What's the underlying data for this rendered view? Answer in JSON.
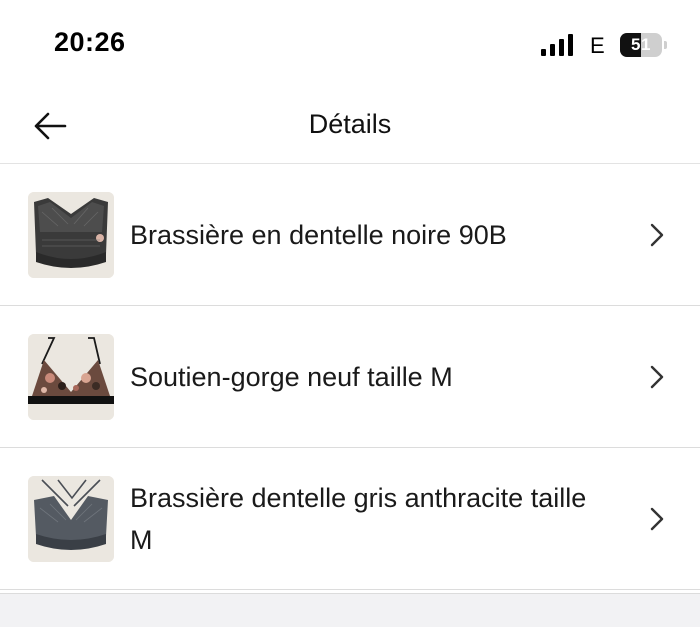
{
  "status_bar": {
    "time": "20:26",
    "signal_icon": "cellular-signal-icon",
    "network": "E",
    "battery": "51",
    "battery_level": 0.51
  },
  "header": {
    "back_icon": "arrow-left-icon",
    "title": "Détails"
  },
  "items": [
    {
      "label": "Brassière en dentelle noire 90B",
      "thumbnail": "black-lace-bralette-photo",
      "chevron_icon": "chevron-right-icon"
    },
    {
      "label": "Soutien-gorge neuf taille M",
      "thumbnail": "floral-triangle-bra-photo",
      "chevron_icon": "chevron-right-icon"
    },
    {
      "label": "Brassière dentelle gris anthracite taille M",
      "thumbnail": "grey-lace-bralette-photo",
      "chevron_icon": "chevron-right-icon"
    }
  ]
}
